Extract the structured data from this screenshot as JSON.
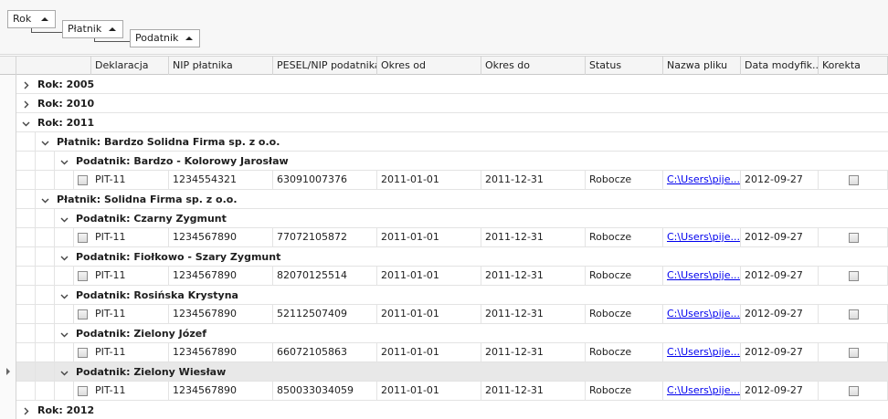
{
  "group_panel": {
    "chips": [
      {
        "label": "Rok"
      },
      {
        "label": "Płatnik"
      },
      {
        "label": "Podatnik"
      }
    ]
  },
  "columns": [
    "Deklaracja",
    "NIP płatnika",
    "PESEL/NIP podatnika",
    "Okres od",
    "Okres do",
    "Status",
    "Nazwa pliku",
    "Data modyfik...",
    "Korekta"
  ],
  "rows": [
    {
      "kind": "group",
      "level": 0,
      "expanded": false,
      "text": "Rok: 2005"
    },
    {
      "kind": "group",
      "level": 0,
      "expanded": false,
      "text": "Rok: 2010"
    },
    {
      "kind": "group",
      "level": 0,
      "expanded": true,
      "text": "Rok: 2011"
    },
    {
      "kind": "group",
      "level": 1,
      "expanded": true,
      "text": "Płatnik: Bardzo Solidna Firma sp. z o.o."
    },
    {
      "kind": "group",
      "level": 2,
      "expanded": true,
      "text": "Podatnik: Bardzo - Kolorowy Jarosław"
    },
    {
      "kind": "data",
      "deklaracja": "PIT-11",
      "nip": "1234554321",
      "pesel": "63091007376",
      "okres_od": "2011-01-01",
      "okres_do": "2011-12-31",
      "status": "Robocze",
      "plik": "C:\\Users\\pije...",
      "data_mod": "2012-09-27",
      "korekta": false
    },
    {
      "kind": "group",
      "level": 1,
      "expanded": true,
      "text": "Płatnik: Solidna Firma sp. z o.o."
    },
    {
      "kind": "group",
      "level": 2,
      "expanded": true,
      "text": "Podatnik: Czarny Zygmunt"
    },
    {
      "kind": "data",
      "deklaracja": "PIT-11",
      "nip": "1234567890",
      "pesel": "77072105872",
      "okres_od": "2011-01-01",
      "okres_do": "2011-12-31",
      "status": "Robocze",
      "plik": "C:\\Users\\pije...",
      "data_mod": "2012-09-27",
      "korekta": false
    },
    {
      "kind": "group",
      "level": 2,
      "expanded": true,
      "text": "Podatnik: Fiołkowo - Szary Zygmunt"
    },
    {
      "kind": "data",
      "deklaracja": "PIT-11",
      "nip": "1234567890",
      "pesel": "82070125514",
      "okres_od": "2011-01-01",
      "okres_do": "2011-12-31",
      "status": "Robocze",
      "plik": "C:\\Users\\pije...",
      "data_mod": "2012-09-27",
      "korekta": false
    },
    {
      "kind": "group",
      "level": 2,
      "expanded": true,
      "text": "Podatnik: Rosińska Krystyna"
    },
    {
      "kind": "data",
      "deklaracja": "PIT-11",
      "nip": "1234567890",
      "pesel": "52112507409",
      "okres_od": "2011-01-01",
      "okres_do": "2011-12-31",
      "status": "Robocze",
      "plik": "C:\\Users\\pije...",
      "data_mod": "2012-09-27",
      "korekta": false
    },
    {
      "kind": "group",
      "level": 2,
      "expanded": true,
      "text": "Podatnik: Zielony Józef"
    },
    {
      "kind": "data",
      "deklaracja": "PIT-11",
      "nip": "1234567890",
      "pesel": "66072105863",
      "okres_od": "2011-01-01",
      "okres_do": "2011-12-31",
      "status": "Robocze",
      "plik": "C:\\Users\\pije...",
      "data_mod": "2012-09-27",
      "korekta": false
    },
    {
      "kind": "group",
      "level": 2,
      "expanded": true,
      "focused": true,
      "text": "Podatnik: Zielony Wiesław"
    },
    {
      "kind": "data",
      "deklaracja": "PIT-11",
      "nip": "1234567890",
      "pesel": "850033034059",
      "okres_od": "2011-01-01",
      "okres_do": "2011-12-31",
      "status": "Robocze",
      "plik": "C:\\Users\\pije...",
      "data_mod": "2012-09-27",
      "korekta": false
    },
    {
      "kind": "group",
      "level": 0,
      "expanded": false,
      "text": "Rok: 2012"
    }
  ]
}
